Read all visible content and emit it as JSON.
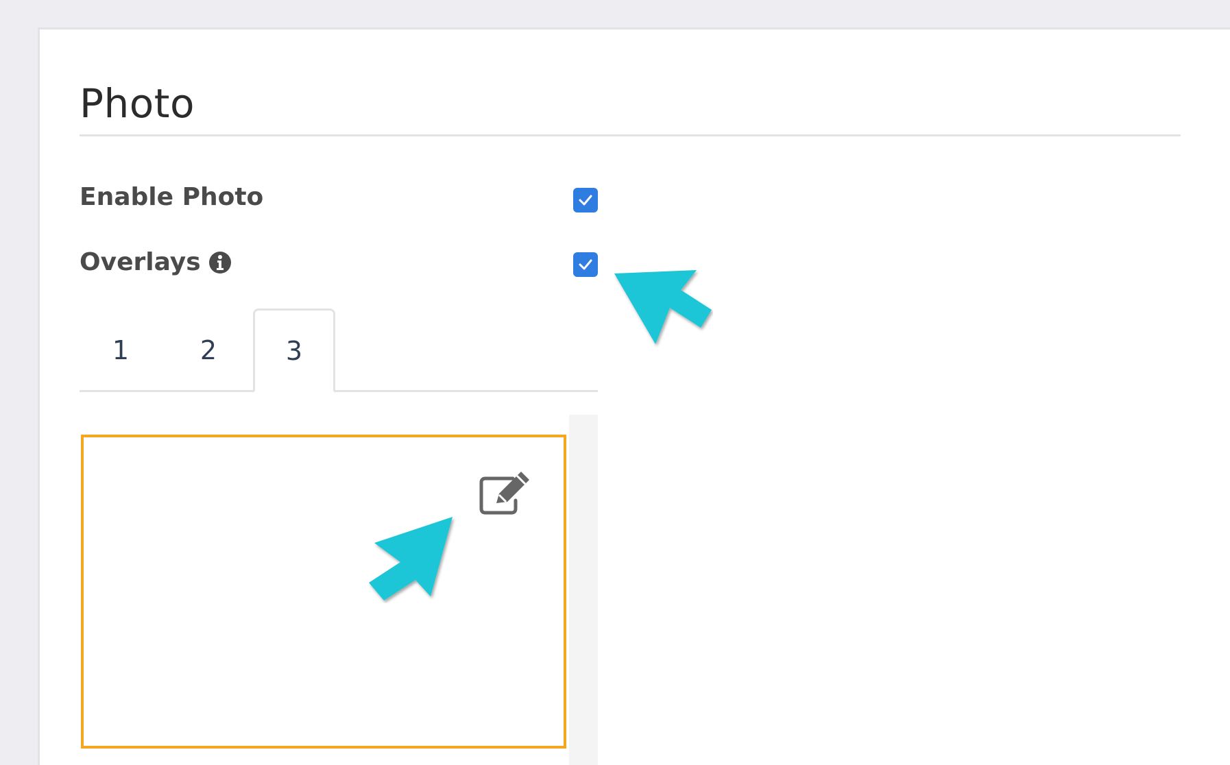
{
  "section": {
    "title": "Photo"
  },
  "settings": [
    {
      "label": "Enable Photo",
      "checked": true
    },
    {
      "label": "Overlays",
      "checked": true,
      "info_icon": "info-circle-icon"
    }
  ],
  "tabs": {
    "items": [
      "1",
      "2",
      "3"
    ],
    "active_label": "3"
  },
  "overlay_editor": {
    "icon": "edit-icon",
    "border_color": "#f5a623"
  },
  "annotations": {
    "arrow_color": "#1ec6d6"
  },
  "colors": {
    "checkbox": "#2f7de1",
    "text": "#4a4a4a",
    "tab_text": "#2f3e52"
  }
}
